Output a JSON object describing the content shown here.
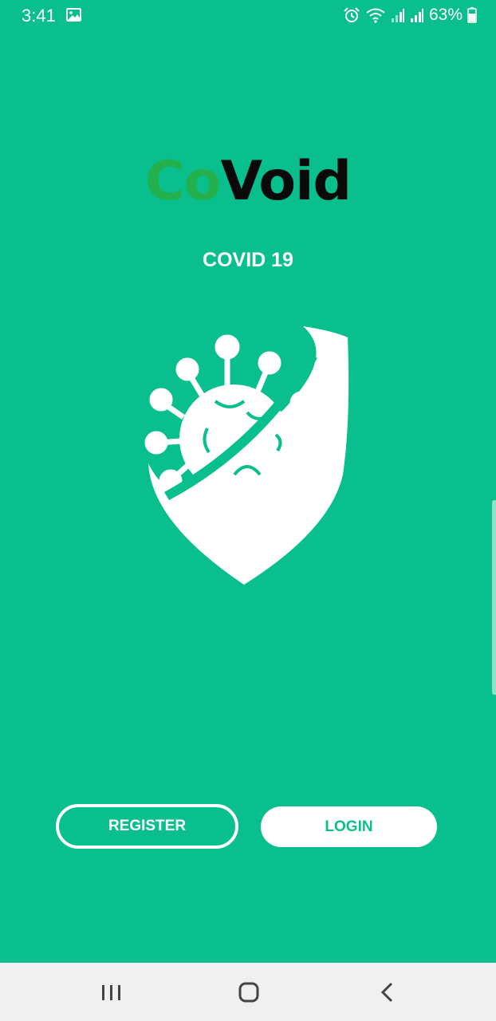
{
  "status_bar": {
    "time": "3:41",
    "battery_percent": "63%",
    "icons": [
      "image-icon",
      "alarm-icon",
      "wifi-icon",
      "signal-icon",
      "signal-icon",
      "battery-icon"
    ]
  },
  "app": {
    "logo_part1": "Co",
    "logo_part2": "Void",
    "subtitle": "COVID 19",
    "shield_icon": "virus-shield-icon"
  },
  "actions": {
    "register_label": "REGISTER",
    "login_label": "LOGIN"
  },
  "nav_bar": {
    "recents_icon": "recents-icon",
    "home_icon": "home-icon",
    "back_icon": "back-icon"
  },
  "colors": {
    "background": "#09bf8d",
    "logo_co": "#22b14c",
    "logo_void": "#0a0a0a",
    "nav_bar": "#f0f0f0"
  }
}
